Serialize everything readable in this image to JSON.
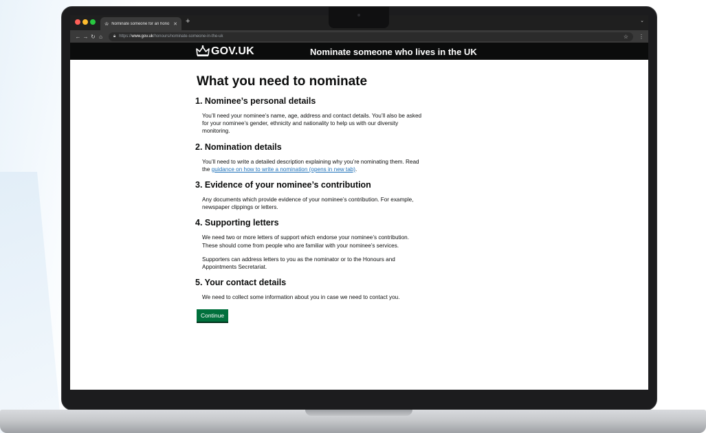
{
  "browser": {
    "tab_title": "Nominate someone for an hono",
    "new_tab": "+",
    "url_prefix": "https://",
    "url_host": "www.gov.uk",
    "url_path": "/honours/nominate-someone-in-the-uk"
  },
  "header": {
    "logo": "GOV.UK",
    "service_name": "Nominate someone who lives in the UK"
  },
  "page": {
    "title": "What you need to nominate",
    "sections": [
      {
        "heading": "1. Nominee’s personal details",
        "paragraphs": [
          "You’ll need your nominee’s name, age, address and contact details. You’ll also be asked for your nominee’s gender, ethnicity and nationality to help us with our diversity monitoring."
        ]
      },
      {
        "heading": "2. Nomination details",
        "paragraph_text": "You’ll need to write a detailed description explaining why you’re nominating them. Read the ",
        "link_text": "guidance on how to write a nomination (opens in new tab)",
        "paragraph_end": "."
      },
      {
        "heading": "3. Evidence of your nominee’s contribution",
        "paragraphs": [
          "Any documents which provide evidence of your nominee’s contribution. For example, newspaper clippings or letters."
        ]
      },
      {
        "heading": "4. Supporting letters",
        "paragraphs": [
          "We need two or more letters of support which endorse your nominee’s contribution. These should come from people who are familiar with your nominee’s services.",
          "Supporters can address letters to you as the nominator or to the Honours and Appointments Secretariat."
        ]
      },
      {
        "heading": "5. Your contact details",
        "paragraphs": [
          "We need to collect some information about you in case we need to contact you."
        ]
      }
    ],
    "continue_label": "Continue"
  },
  "icons": {
    "back": "back-arrow-icon",
    "forward": "forward-arrow-icon",
    "reload": "reload-icon",
    "home": "home-icon",
    "lock": "lock-icon",
    "star": "bookmark-star-icon",
    "menu": "more-menu-icon",
    "crown": "crown-icon"
  },
  "colors": {
    "govuk_header": "#0b0c0c",
    "button_green": "#00703c",
    "link_blue": "#1d70b8",
    "text": "#0b0c0c"
  }
}
